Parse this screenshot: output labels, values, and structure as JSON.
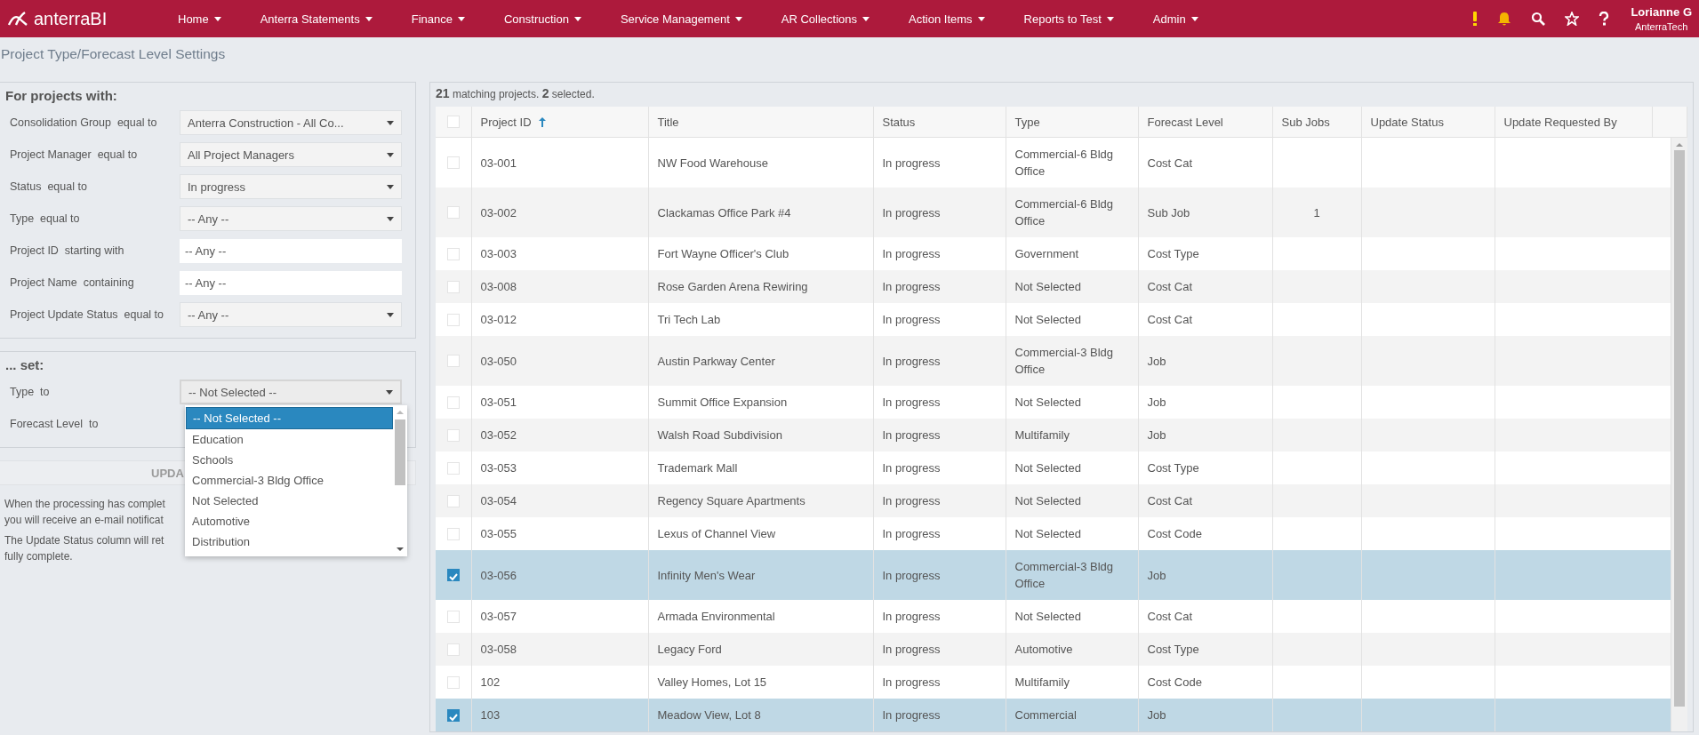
{
  "nav": {
    "logo": "anterraBI",
    "menu": [
      {
        "label": "Home"
      },
      {
        "label": "Anterra Statements"
      },
      {
        "label": "Finance"
      },
      {
        "label": "Construction"
      },
      {
        "label": "Service Management"
      },
      {
        "label": "AR Collections"
      },
      {
        "label": "Action Items"
      },
      {
        "label": "Reports to Test"
      },
      {
        "label": "Admin"
      }
    ],
    "user": {
      "name": "Lorianne G",
      "company": "AnterraTech"
    }
  },
  "page_title": "Project Type/Forecast Level Settings",
  "filters": {
    "heading": "For projects with:",
    "rows": [
      {
        "label": "Consolidation Group  equal to",
        "kind": "select",
        "value": "Anterra Construction - All Co..."
      },
      {
        "label": "Project Manager  equal to",
        "kind": "select",
        "value": "All Project Managers"
      },
      {
        "label": "Status  equal to",
        "kind": "select",
        "value": "In progress"
      },
      {
        "label": "Type  equal to",
        "kind": "select",
        "value": "-- Any --"
      },
      {
        "label": "Project ID  starting with",
        "kind": "text",
        "placeholder": "-- Any --"
      },
      {
        "label": "Project Name  containing",
        "kind": "text",
        "placeholder": "-- Any --"
      },
      {
        "label": "Project Update Status  equal to",
        "kind": "select",
        "value": "-- Any --"
      }
    ]
  },
  "set_panel": {
    "heading": "... set:",
    "rows": [
      {
        "label": "Type  to",
        "kind": "select",
        "value": "-- Not Selected --",
        "expanded": true,
        "options": [
          {
            "label": "-- Not Selected --",
            "selected": true
          },
          {
            "label": "Education",
            "selected": false
          },
          {
            "label": "Schools",
            "selected": false
          },
          {
            "label": "Commercial-3 Bldg Office",
            "selected": false
          },
          {
            "label": "Not Selected",
            "selected": false
          },
          {
            "label": "Automotive",
            "selected": false
          },
          {
            "label": "Distribution",
            "selected": false
          }
        ]
      },
      {
        "label": "Forecast Level  to",
        "kind": "hidden"
      }
    ]
  },
  "update_button": "UPDA",
  "notes": [
    "When the processing has complet",
    "you will receive an e-mail notificat",
    "The Update Status column will ret",
    "fully complete."
  ],
  "table": {
    "summary": "**21** matching projects. **2** selected.",
    "all_checked": false,
    "columns": [
      {
        "label": "Project ID",
        "sorted_ascending": true
      },
      {
        "label": "Title",
        "sorted_ascending": false
      },
      {
        "label": "Status",
        "sorted_ascending": false
      },
      {
        "label": "Type",
        "sorted_ascending": false
      },
      {
        "label": "Forecast Level",
        "sorted_ascending": false
      },
      {
        "label": "Sub Jobs",
        "sorted_ascending": false
      },
      {
        "label": "Update Status",
        "sorted_ascending": false
      },
      {
        "label": "Update Requested By",
        "sorted_ascending": false
      }
    ],
    "rows": [
      {
        "selected": false,
        "id": "03-001",
        "title": "NW Food Warehouse",
        "status": "In progress",
        "type": "Commercial-6 Bldg Office",
        "forecast_level": "Cost Cat"
      },
      {
        "selected": false,
        "id": "03-002",
        "title": "Clackamas Office Park #4",
        "status": "In progress",
        "type": "Commercial-6 Bldg Office",
        "forecast_level": "Sub Job",
        "sub_jobs": "1"
      },
      {
        "selected": false,
        "id": "03-003",
        "title": "Fort Wayne Officer's Club",
        "status": "In progress",
        "type": "Government",
        "forecast_level": "Cost Type"
      },
      {
        "selected": false,
        "id": "03-008",
        "title": "Rose Garden Arena Rewiring",
        "status": "In progress",
        "type": "Not Selected",
        "forecast_level": "Cost Cat"
      },
      {
        "selected": false,
        "id": "03-012",
        "title": "Tri Tech Lab",
        "status": "In progress",
        "type": "Not Selected",
        "forecast_level": "Cost Cat"
      },
      {
        "selected": false,
        "id": "03-050",
        "title": "Austin Parkway Center",
        "status": "In progress",
        "type": "Commercial-3 Bldg Office",
        "forecast_level": "Job"
      },
      {
        "selected": false,
        "id": "03-051",
        "title": "Summit Office Expansion",
        "status": "In progress",
        "type": "Not Selected",
        "forecast_level": "Job"
      },
      {
        "selected": false,
        "id": "03-052",
        "title": "Walsh Road Subdivision",
        "status": "In progress",
        "type": "Multifamily",
        "forecast_level": "Job"
      },
      {
        "selected": false,
        "id": "03-053",
        "title": "Trademark Mall",
        "status": "In progress",
        "type": "Not Selected",
        "forecast_level": "Cost Type"
      },
      {
        "selected": false,
        "id": "03-054",
        "title": "Regency Square Apartments",
        "status": "In progress",
        "type": "Not Selected",
        "forecast_level": "Cost Cat"
      },
      {
        "selected": false,
        "id": "03-055",
        "title": "Lexus of Channel View",
        "status": "In progress",
        "type": "Not Selected",
        "forecast_level": "Cost Code"
      },
      {
        "selected": true,
        "id": "03-056",
        "title": "Infinity Men's Wear",
        "status": "In progress",
        "type": "Commercial-3 Bldg Office",
        "forecast_level": "Job"
      },
      {
        "selected": false,
        "id": "03-057",
        "title": "Armada Environmental",
        "status": "In progress",
        "type": "Not Selected",
        "forecast_level": "Cost Cat"
      },
      {
        "selected": false,
        "id": "03-058",
        "title": "Legacy Ford",
        "status": "In progress",
        "type": "Automotive",
        "forecast_level": "Cost Type"
      },
      {
        "selected": false,
        "id": "102",
        "title": "Valley Homes, Lot 15",
        "status": "In progress",
        "type": "Multifamily",
        "forecast_level": "Cost Code"
      },
      {
        "selected": true,
        "id": "103",
        "title": "Meadow View, Lot 8",
        "status": "In progress",
        "type": "Commercial",
        "forecast_level": "Job"
      }
    ]
  }
}
